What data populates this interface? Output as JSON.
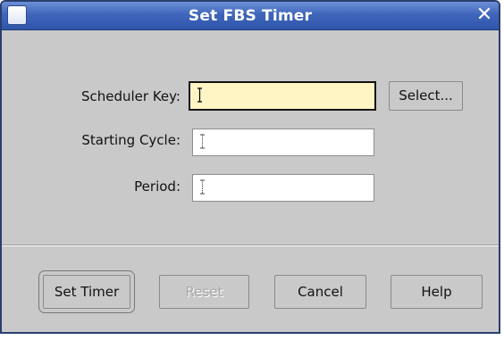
{
  "window": {
    "title": "Set FBS Timer",
    "close_glyph": "✕"
  },
  "form": {
    "scheduler_key": {
      "label": "Scheduler Key:",
      "value": "",
      "focused": true
    },
    "starting_cycle": {
      "label": "Starting Cycle:",
      "value": ""
    },
    "period": {
      "label": "Period:",
      "value": ""
    },
    "select_button_label": "Select..."
  },
  "buttons": {
    "set_timer": "Set Timer",
    "reset": "Reset",
    "cancel": "Cancel",
    "help": "Help"
  },
  "icons": {
    "window_menu": "window-menu-icon",
    "close": "close-icon",
    "text_cursor": "text-cursor-icon"
  },
  "colors": {
    "titlebar": "#3f66bb",
    "dialog_background": "#c9c9c9",
    "focused_field_background": "#fff4c4",
    "disabled_text": "#a8a8a8"
  },
  "states": {
    "reset_disabled": true,
    "set_timer_default": true
  }
}
